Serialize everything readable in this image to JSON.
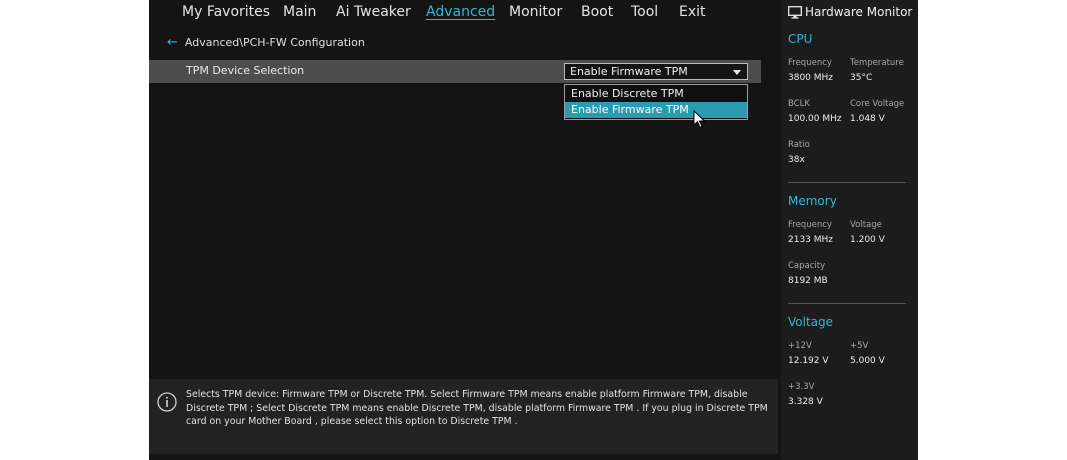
{
  "nav": {
    "tabs": [
      {
        "label": "My Favorites"
      },
      {
        "label": "Main"
      },
      {
        "label": "Ai Tweaker"
      },
      {
        "label": "Advanced"
      },
      {
        "label": "Monitor"
      },
      {
        "label": "Boot"
      },
      {
        "label": "Tool"
      },
      {
        "label": "Exit"
      }
    ],
    "active_tab": "Advanced"
  },
  "breadcrumb": {
    "path": "Advanced\\PCH-FW Configuration"
  },
  "setting": {
    "label": "TPM Device Selection",
    "value": "Enable Firmware TPM",
    "options": [
      "Enable Discrete TPM",
      "Enable Firmware TPM"
    ],
    "highlighted_option": "Enable Firmware TPM"
  },
  "help": {
    "text": "Selects TPM device: Firmware TPM or Discrete TPM. Select Firmware TPM  means enable platform Firmware TPM, disable Discrete TPM ; Select Discrete TPM  means enable Discrete TPM, disable platform Firmware TPM . If you plug in Discrete TPM card on your Mother Board , please select  this option to Discrete TPM ."
  },
  "hardware_monitor": {
    "title": "Hardware Monitor",
    "cpu": {
      "heading": "CPU",
      "frequency_label": "Frequency",
      "frequency": "3800 MHz",
      "temperature_label": "Temperature",
      "temperature": "35°C",
      "bclk_label": "BCLK",
      "bclk": "100.00 MHz",
      "core_voltage_label": "Core Voltage",
      "core_voltage": "1.048 V",
      "ratio_label": "Ratio",
      "ratio": "38x"
    },
    "memory": {
      "heading": "Memory",
      "frequency_label": "Frequency",
      "frequency": "2133 MHz",
      "voltage_label": "Voltage",
      "voltage": "1.200 V",
      "capacity_label": "Capacity",
      "capacity": "8192 MB"
    },
    "voltage": {
      "heading": "Voltage",
      "v12_label": "+12V",
      "v12": "12.192 V",
      "v5_label": "+5V",
      "v5": "5.000 V",
      "v33_label": "+3.3V",
      "v33": "3.328 V"
    }
  },
  "colors": {
    "accent": "#2fb8d6",
    "highlight": "#2a9bb0",
    "annotation_arrow": "#f2ea1c",
    "background": "#141414",
    "row_selected": "#4d4d4d"
  },
  "icons": {
    "back": "arrow-left-icon",
    "help": "info-icon",
    "monitor": "monitor-icon",
    "cursor": "mouse-pointer-icon",
    "annotation": "curved-arrow-icon"
  }
}
